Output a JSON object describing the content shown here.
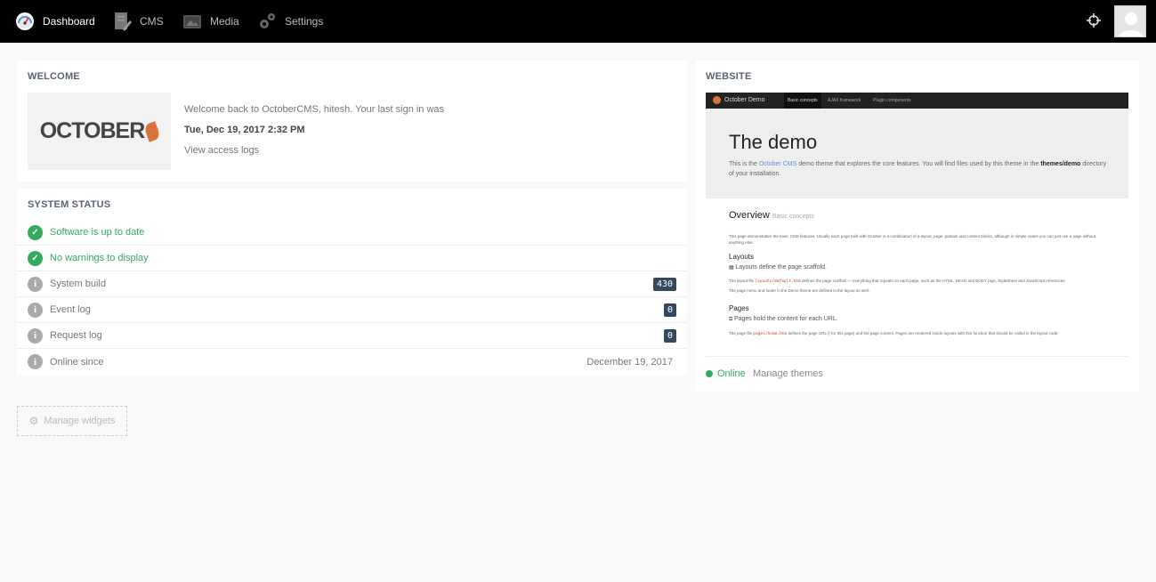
{
  "nav": {
    "items": [
      {
        "label": "Dashboard",
        "icon": "dashboard-gauge-icon"
      },
      {
        "label": "CMS",
        "icon": "cms-document-icon"
      },
      {
        "label": "Media",
        "icon": "media-image-icon"
      },
      {
        "label": "Settings",
        "icon": "settings-gears-icon"
      }
    ],
    "active": "Dashboard"
  },
  "welcome": {
    "title": "WELCOME",
    "logo_text": "OCTOBER",
    "message": "Welcome back to OctoberCMS, hitesh. Your last sign in was",
    "last_signin": "Tue, Dec 19, 2017 2:32 PM",
    "access_logs_link": "View access logs"
  },
  "system_status": {
    "title": "SYSTEM STATUS",
    "rows": [
      {
        "label": "Software is up to date",
        "status": "ok"
      },
      {
        "label": "No warnings to display",
        "status": "ok"
      },
      {
        "label": "System build",
        "status": "info",
        "badge": "430"
      },
      {
        "label": "Event log",
        "status": "info",
        "badge": "0"
      },
      {
        "label": "Request log",
        "status": "info",
        "badge": "0"
      },
      {
        "label": "Online since",
        "status": "info",
        "value": "December 19, 2017"
      }
    ]
  },
  "manage_widgets_label": "Manage widgets",
  "website": {
    "title": "WEBSITE",
    "preview": {
      "brand": "October Demo",
      "links": [
        "Basic concepts",
        "AJAX framework",
        "Plugin components"
      ],
      "hero_title": "The demo",
      "hero_text_a": "This is the ",
      "hero_text_link": "October CMS",
      "hero_text_b": " demo theme that explores the core features. You will find files used by this theme in the ",
      "hero_text_bold": "themes/demo",
      "hero_text_c": " directory of your installation.",
      "overview_title": "Overview",
      "overview_sub": "Basic concepts",
      "overview_text": "This page demonstrates the basic CMS features. Usually each page built with October is a combination of a layout, page, partials and content blocks, although in simple cases you can just use a page without anything else.",
      "layouts_title": "Layouts",
      "layouts_lead": "Layouts define the page scaffold.",
      "layouts_text_a": "The layout file ",
      "layouts_text_code": "layouts/default.htm",
      "layouts_text_b": " defines the page scaffold — everything that repeats on each page, such as the HTML, HEAD and BODY tags, StyleSheet and JavaScript references.",
      "layouts_text2": "The page menu and footer in the Demo theme are defined in the layout as well.",
      "pages_title": "Pages",
      "pages_lead": "Pages hold the content for each URL.",
      "pages_text_a": "The page file ",
      "pages_text_code": "pages/home.htm",
      "pages_text_b": " defines the page URL (",
      "pages_text_url": "/",
      "pages_text_c": " for this page) and the page content. Pages are rendered inside layouts with this function that should be called in the layout code:"
    },
    "status": "Online",
    "manage_themes": "Manage themes"
  },
  "colors": {
    "accent_green": "#31ac5f",
    "badge_bg": "#34495e",
    "nav_bg": "#000000",
    "brand_orange": "#d9733b"
  }
}
